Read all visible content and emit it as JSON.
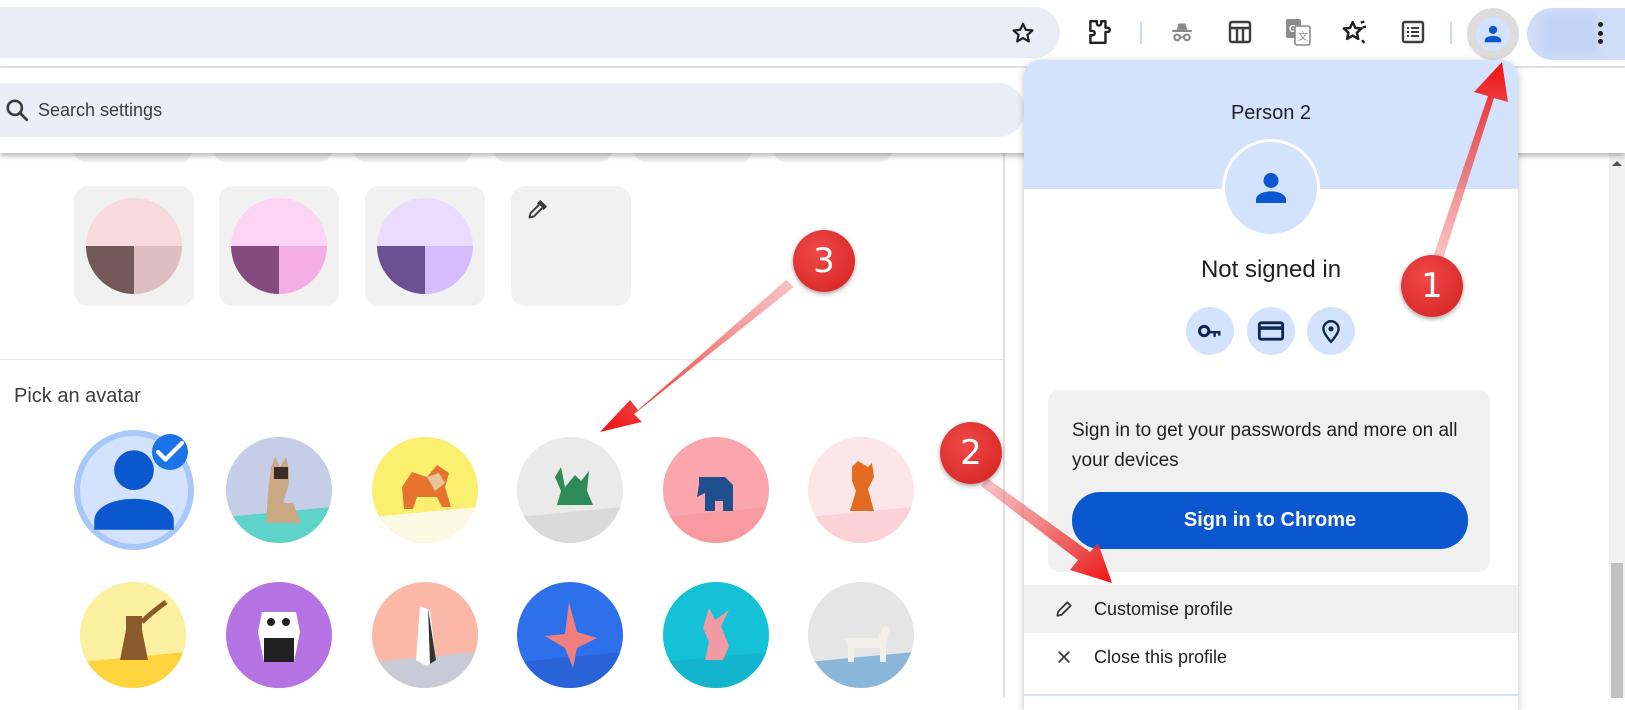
{
  "toolbar": {
    "bookmark_icon": "star-outline-icon",
    "extensions_icon": "puzzle-icon",
    "incognito_icon": "incognito-icon",
    "tab_layout_icon": "layout-icon",
    "translate_icon": "translate-icon",
    "bookmarks_icon": "star-list-icon",
    "reading_list_icon": "reading-list-icon",
    "profile_icon": "person-icon",
    "menu_icon": "more-vert-icon"
  },
  "settings": {
    "search_placeholder": "Search settings",
    "color_tiles": [
      {
        "name": "pink",
        "top": "#f8dade",
        "left": "#735858",
        "right": "#dfbec2"
      },
      {
        "name": "magenta",
        "top": "#fdd4f4",
        "left": "#864b7e",
        "right": "#f5aee5"
      },
      {
        "name": "lavender",
        "top": "#eadcfe",
        "left": "#6c5192",
        "right": "#d5bcfc"
      }
    ],
    "custom_color_icon": "eyedropper-icon",
    "avatar_heading": "Pick an avatar",
    "avatars": [
      {
        "name": "default-person",
        "selected": true
      },
      {
        "name": "cat",
        "bg": "#c6cde6",
        "accent": "#5dd3c9"
      },
      {
        "name": "corgi",
        "bg": "#fbef70",
        "accent": "#fcf9e3"
      },
      {
        "name": "dragon",
        "bg": "#eaeaea",
        "accent": "#dadada"
      },
      {
        "name": "elephant",
        "bg": "#fba5ac",
        "accent": "#f99aa0"
      },
      {
        "name": "fox",
        "bg": "#fce6ea",
        "accent": "#fbd2d6"
      },
      {
        "name": "monkey",
        "bg": "#fbf09f",
        "accent": "#fdd43e"
      },
      {
        "name": "panda",
        "bg": "#b573e4",
        "accent": "#b573e4"
      },
      {
        "name": "penguin",
        "bg": "#fcb8a6",
        "accent": "#c8cbd6"
      },
      {
        "name": "butterfly",
        "bg": "#2e70ec",
        "accent": "#2a63d8"
      },
      {
        "name": "rabbit",
        "bg": "#14c1d6",
        "accent": "#12b5cb"
      },
      {
        "name": "unicorn",
        "bg": "#e5e5e5",
        "accent": "#8ab7d9"
      }
    ]
  },
  "profile_popup": {
    "name": "Person 2",
    "status": "Not signed in",
    "quick_actions": [
      {
        "icon": "key-icon",
        "label": "Passwords"
      },
      {
        "icon": "credit-card-icon",
        "label": "Payment methods"
      },
      {
        "icon": "location-pin-icon",
        "label": "Addresses"
      }
    ],
    "signin_prompt": "Sign in to get your passwords and more on all your devices",
    "signin_button": "Sign in to Chrome",
    "menu": [
      {
        "icon": "pencil-icon",
        "label": "Customise profile"
      },
      {
        "icon": "close-icon",
        "label": "Close this profile"
      }
    ]
  },
  "annotations": [
    {
      "number": "1"
    },
    {
      "number": "2"
    },
    {
      "number": "3"
    }
  ],
  "colors": {
    "accent": "#0b57d0",
    "header_bg": "#d3e3fd",
    "annotation_red": "#e0282a"
  }
}
